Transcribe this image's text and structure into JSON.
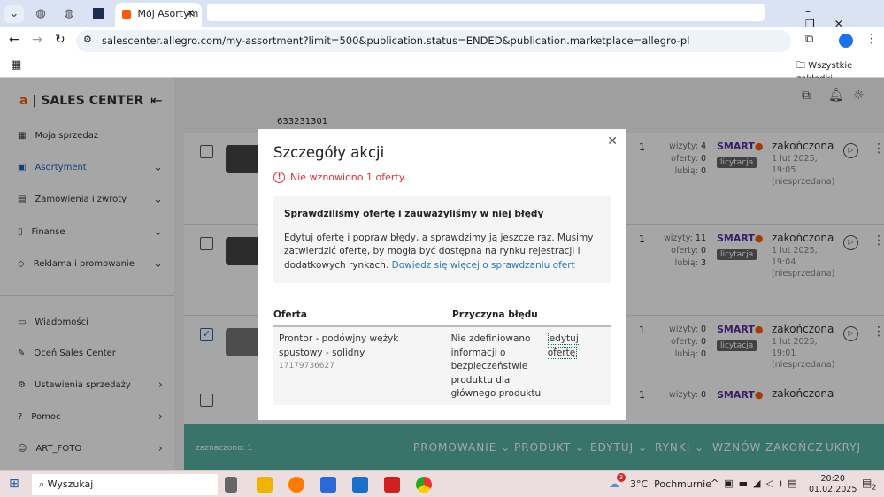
{
  "browser": {
    "active_tab_title": "Mój Asortym",
    "url": "salescenter.allegro.com/my-assortment?limit=500&publication.status=ENDED&publication.marketplace=allegro-pl",
    "bookmarks_label": "Wszystkie zakładki"
  },
  "sidebar": {
    "logo": "SALES CENTER",
    "items": [
      {
        "label": "Moja sprzedaż",
        "icon": "grid-icon"
      },
      {
        "label": "Asortyment",
        "icon": "box-icon"
      },
      {
        "label": "Zamówienia i zwroty",
        "icon": "cart-icon"
      },
      {
        "label": "Finanse",
        "icon": "document-icon"
      },
      {
        "label": "Reklama i promowanie",
        "icon": "tag-icon"
      },
      {
        "label": "Wiadomości",
        "icon": "chat-icon"
      },
      {
        "label": "Oceń Sales Center",
        "icon": "edit-icon"
      },
      {
        "label": "Ustawienia sprzedaży",
        "icon": "gear-icon"
      },
      {
        "label": "Pomoc",
        "icon": "help-icon"
      },
      {
        "label": "ART_FOTO",
        "icon": "user-icon"
      }
    ],
    "accent": "#ff5a00"
  },
  "list": {
    "top_id": "633231301",
    "rows": [
      {
        "qty": "1",
        "visits": "4",
        "offers": "0",
        "likes": "0",
        "badge": "licytacja",
        "status": "zakończona",
        "date": "1 lut 2025,",
        "time": "19:05",
        "note": "(niesprzedana)",
        "checked": false
      },
      {
        "qty": "1",
        "visits": "11",
        "offers": "0",
        "likes": "3",
        "badge": "licytacja",
        "status": "zakończona",
        "date": "1 lut 2025,",
        "time": "19:04",
        "note": "(niesprzedana)",
        "checked": false
      },
      {
        "qty": "1",
        "visits": "0",
        "offers": "0",
        "likes": "0",
        "badge": "licytacja",
        "status": "zakończona",
        "date": "1 lut 2025,",
        "time": "19:01",
        "note": "(niesprzedana)",
        "checked": true
      },
      {
        "qty": "1",
        "visits": "0",
        "status": "zakończona"
      }
    ],
    "labels": {
      "visits": "wizyty:",
      "offers": "oferty:",
      "likes": "lubią:",
      "smart": "SMART"
    }
  },
  "bottom_bar": {
    "selected": "zaznaczono: 1",
    "actions": [
      "PROMOWANIE",
      "PRODUKT",
      "EDYTUJ",
      "RYNKI",
      "WZNÓW",
      "ZAKOŃCZ",
      "UKRYJ"
    ]
  },
  "modal": {
    "title": "Szczegóły akcji",
    "error": "Nie wznowiono 1 oferty.",
    "info_title": "Sprawdziliśmy ofertę i zauważyliśmy w niej błędy",
    "info_text": "Edytuj ofertę i popraw błędy, a sprawdzimy ją jeszcze raz. Musimy zatwierdzić ofertę, by mogła być dostępna na rynku rejestracji i dodatkowych rynkach.",
    "info_link": "Dowiedz się więcej o sprawdzaniu ofert",
    "col_offer": "Oferta",
    "col_reason": "Przyczyna błędu",
    "offer_name": "Prontor - podówjny wężyk spustowy - solidny",
    "offer_id": "17179736627",
    "reason": "Nie zdefiniowano informacji o bezpieczeństwie produktu dla głównego produktu",
    "edit_link": "edytuj ofertę"
  },
  "taskbar": {
    "search": "Wyszukaj",
    "weather": "3°C  Pochmurnie",
    "weather_badge": "3",
    "time": "20:20",
    "date": "01.02.2025",
    "notifications": "2"
  }
}
